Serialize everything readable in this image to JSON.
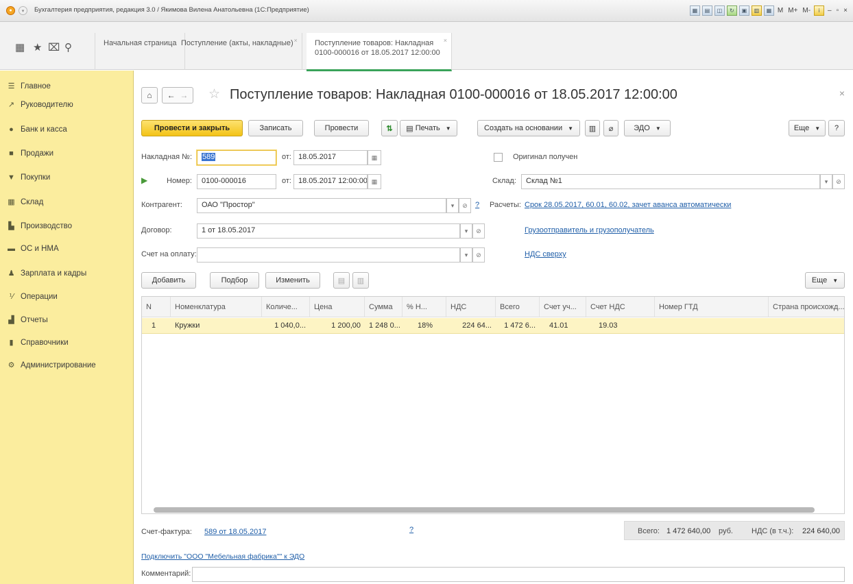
{
  "window": {
    "title": "Бухгалтерия предприятия, редакция 3.0 / Якимова Вилена Анатольевна (1С:Предприятие)"
  },
  "tabs": [
    {
      "label": "Начальная страница"
    },
    {
      "label": "Поступление (акты, накладные)"
    },
    {
      "label_line1": "Поступление товаров: Накладная",
      "label_line2": "0100-000016 от 18.05.2017 12:00:00"
    }
  ],
  "sidebar": {
    "items": [
      {
        "label": "Главное",
        "icon": "menu-icon"
      },
      {
        "label": "Руководителю",
        "icon": "chart-line-icon"
      },
      {
        "label": "Банк и касса",
        "icon": "coin-icon"
      },
      {
        "label": "Продажи",
        "icon": "shop-icon"
      },
      {
        "label": "Покупки",
        "icon": "cart-icon"
      },
      {
        "label": "Склад",
        "icon": "warehouse-icon"
      },
      {
        "label": "Производство",
        "icon": "factory-icon"
      },
      {
        "label": "ОС и НМА",
        "icon": "truck-icon"
      },
      {
        "label": "Зарплата и кадры",
        "icon": "person-icon"
      },
      {
        "label": "Операции",
        "icon": "operations-icon"
      },
      {
        "label": "Отчеты",
        "icon": "bar-chart-icon"
      },
      {
        "label": "Справочники",
        "icon": "book-icon"
      },
      {
        "label": "Администрирование",
        "icon": "gear-icon"
      }
    ]
  },
  "document": {
    "title": "Поступление товаров: Накладная 0100-000016 от 18.05.2017 12:00:00"
  },
  "toolbar": {
    "post_and_close": "Провести и закрыть",
    "save": "Записать",
    "post": "Провести",
    "print": "Печать",
    "create_based_on": "Создать на основании",
    "edo": "ЭДО",
    "more": "Еще",
    "help": "?"
  },
  "form": {
    "invoice_no_label": "Накладная №:",
    "invoice_no_value": "589",
    "from_label": "от:",
    "invoice_date": "18.05.2017",
    "original_received": "Оригинал получен",
    "number_label": "Номер:",
    "number_value": "0100-000016",
    "number_date": "18.05.2017 12:00:00",
    "warehouse_label": "Склад:",
    "warehouse_value": "Склад №1",
    "counterparty_label": "Контрагент:",
    "counterparty_value": "ОАО \"Простор\"",
    "settlements_label": "Расчеты:",
    "settlements_link": "Срок 28.05.2017, 60.01, 60.02, зачет аванса автоматически",
    "contract_label": "Договор:",
    "contract_value": "1 от 18.05.2017",
    "shipper_link": "Грузоотправитель и грузополучатель",
    "payment_invoice_label": "Счет на оплату:",
    "payment_invoice_value": "",
    "vat_link": "НДС сверху",
    "help_mark": "?"
  },
  "table_toolbar": {
    "add": "Добавить",
    "pick": "Подбор",
    "change": "Изменить",
    "more": "Еще"
  },
  "table": {
    "columns": [
      "N",
      "Номенклатура",
      "Количе...",
      "Цена",
      "Сумма",
      "% Н...",
      "НДС",
      "Всего",
      "Счет уч...",
      "Счет НДС",
      "Номер ГТД",
      "Страна происхожд..."
    ],
    "rows": [
      [
        "1",
        "Кружки",
        "1 040,0...",
        "1 200,00",
        "1 248 0...",
        "18%",
        "224 64...",
        "1 472 6...",
        "41.01",
        "19.03",
        "",
        ""
      ]
    ]
  },
  "footer": {
    "invoice_label": "Счет-фактура:",
    "invoice_link": "589 от 18.05.2017",
    "help_mark": "?",
    "total_label": "Всего:",
    "total_value": "1 472 640,00",
    "currency": "руб.",
    "vat_label": "НДС (в т.ч.):",
    "vat_value": "224 640,00",
    "edo_link": "Подключить \"ООО \"Мебельная фабрика\"\" к ЭДО",
    "comment_label": "Комментарий:",
    "comment_value": ""
  }
}
